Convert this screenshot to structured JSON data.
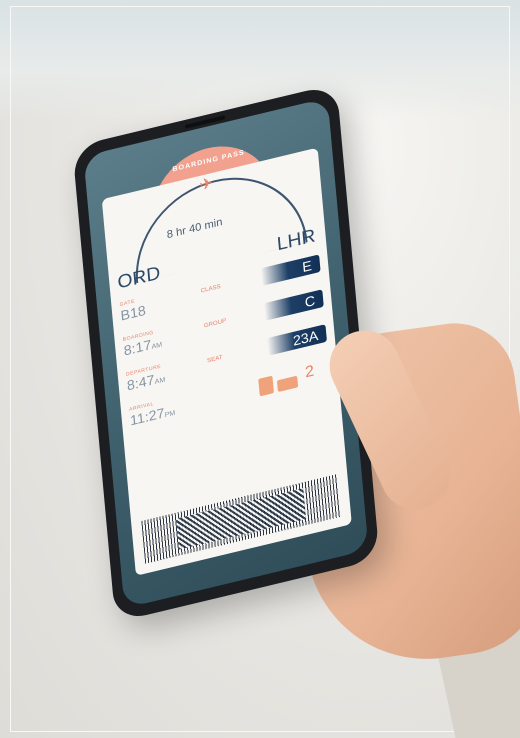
{
  "boarding_pass": {
    "header": "BOARDING PASS",
    "duration": "8 hr 40 min",
    "origin": "ORD",
    "destination": "LHR",
    "gate": {
      "label": "GATE",
      "value": "B18"
    },
    "boarding": {
      "label": "BOARDING",
      "time": "8:17",
      "meridiem": "AM"
    },
    "departure": {
      "label": "DEPARTURE",
      "time": "8:47",
      "meridiem": "AM"
    },
    "arrival": {
      "label": "ARRIVAL",
      "time": "11:27",
      "meridiem": "PM"
    },
    "class": {
      "label": "CLASS",
      "value": "E"
    },
    "group": {
      "label": "GROUP",
      "value": "C"
    },
    "seat": {
      "label": "SEAT",
      "value": "23A"
    },
    "bags": {
      "count": "2",
      "icon": "luggage-icon"
    },
    "plane_icon": "airplane-icon"
  },
  "colors": {
    "accent": "#e8826a",
    "navy": "#1d3f66",
    "tab": "#f1a18e",
    "ticket": "#f7f6f3"
  }
}
